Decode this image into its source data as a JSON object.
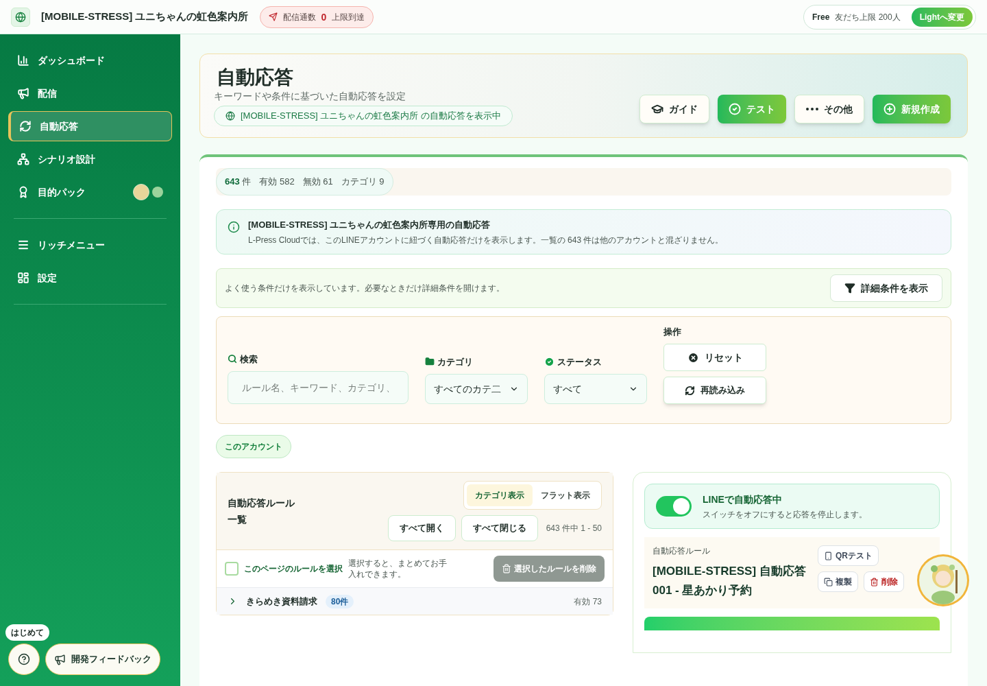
{
  "header": {
    "account": "[MOBILE-STRESS] ユニちゃんの虹色案内所",
    "quota": {
      "label": "配信通数",
      "count": "0",
      "status": "上限到達"
    },
    "plan": {
      "name": "Free",
      "limit": "友だち上限 200人",
      "upgrade": "Lightへ変更"
    }
  },
  "sidebar": {
    "items": [
      {
        "label": "ダッシュボード",
        "selected": false
      },
      {
        "label": "配信",
        "selected": false
      },
      {
        "label": "自動応答",
        "selected": true
      },
      {
        "label": "シナリオ設計",
        "selected": false
      },
      {
        "label": "目的パック",
        "selected": false
      }
    ],
    "items2": [
      {
        "label": "リッチメニュー",
        "selected": false
      },
      {
        "label": "設定",
        "selected": false
      }
    ],
    "tip": "はじめて",
    "feedback": "開発フィードバック"
  },
  "page": {
    "title": "自動応答",
    "subtitle": "キーワードや条件に基づいた自動応答を設定",
    "scope": "[MOBILE-STRESS] ユニちゃんの虹色案内所 の自動応答を表示中",
    "actions": [
      {
        "label": "ガイド",
        "kind": "plain"
      },
      {
        "label": "テスト",
        "kind": "primary"
      },
      {
        "label": "その他",
        "kind": "plain"
      },
      {
        "label": "新規作成",
        "kind": "primary"
      }
    ]
  },
  "stats": {
    "total": "643",
    "total_unit": "件",
    "active": "有効 582",
    "inactive": "無効 61",
    "categories": "カテゴリ 9"
  },
  "notice": {
    "title": "[MOBILE-STRESS] ユニちゃんの虹色案内所専用の自動応答",
    "body": "L-Press Cloudでは、このLINEアカウントに紐づく自動応答だけを表示します。一覧の 643 件は他のアカウントと混ざりません。"
  },
  "filter_hint": {
    "text": "よく使う条件だけを表示しています。必要なときだけ詳細条件を開けます。",
    "button": "詳細条件を表示"
  },
  "filters": {
    "search": {
      "label": "検索",
      "placeholder": "ルール名、キーワード、カテゴリ、"
    },
    "category": {
      "label": "カテゴリ",
      "value": "すべてのカテ二"
    },
    "status": {
      "label": "ステータス",
      "value": "すべて"
    },
    "ops_label": "操作",
    "reset": "リセット",
    "reload": "再読み込み"
  },
  "scope_chip": "このアカウント",
  "rules": {
    "title": "自動応答ルール一覧",
    "views": [
      {
        "label": "カテゴリ表示",
        "selected": true
      },
      {
        "label": "フラット表示",
        "selected": false
      }
    ],
    "expand": "すべて開く",
    "collapse": "すべて閉じる",
    "range": "643 件中 1 - 50",
    "select_label": "このページのルールを選択",
    "select_checked": false,
    "select_hint": "選択すると、まとめてお手入れできます。",
    "bulk_delete": "選択したルールを削除",
    "bulk_disabled": true,
    "categories": [
      {
        "name": "きらめき資料請求",
        "count": "80件",
        "active": "有効 73",
        "expanded": false
      }
    ]
  },
  "detail": {
    "toggle_on": true,
    "toggle_title": "LINEで自動応答中",
    "toggle_hint": "スイッチをオフにすると応答を停止します。",
    "label": "自動応答ルール",
    "name": "[MOBILE-STRESS] 自動応答 001 - 星あかり予約",
    "qr": "QRテスト",
    "copy": "複製",
    "delete": "削除"
  }
}
